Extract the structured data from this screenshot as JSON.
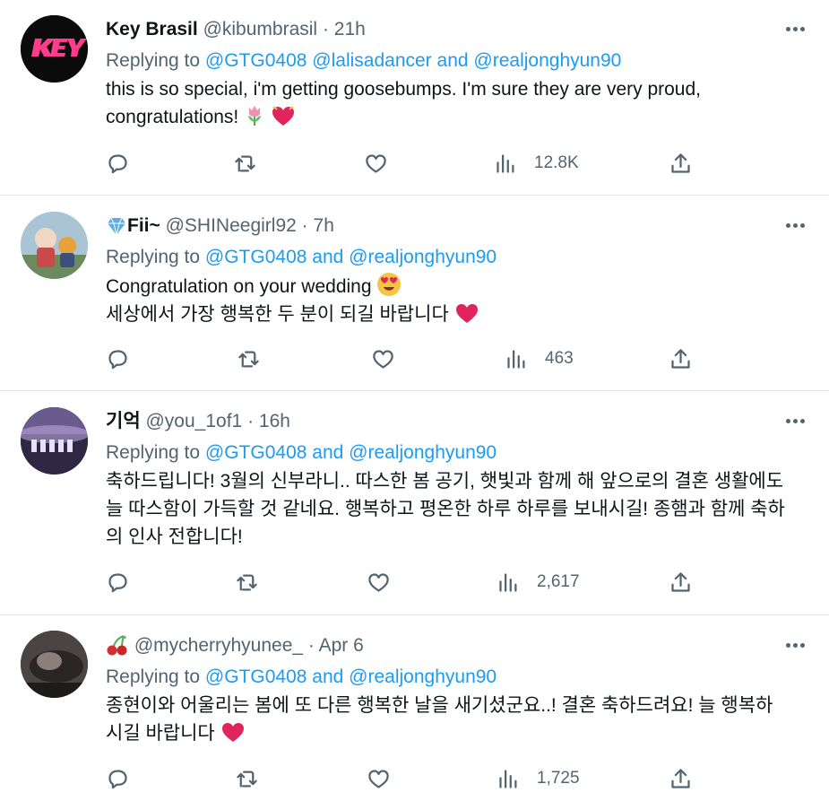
{
  "tweets": [
    {
      "display_name": "Key Brasil",
      "handle": "@kibumbrasil",
      "time": "21h",
      "replying_prefix": "Replying to ",
      "replying_1": "@GTG0408",
      "replying_2": "@lalisadancer",
      "replying_and": "and",
      "replying_3": "@realjonghyun90",
      "line1": "this is so special, i'm getting goosebumps. I'm sure they are very proud,",
      "line2": "congratulations!",
      "views": "12.8K"
    },
    {
      "display_name": "Fii~",
      "handle": "@SHINeegirl92",
      "time": "7h",
      "replying_prefix": "Replying to ",
      "replying_1": "@GTG0408",
      "replying_and": "and",
      "replying_2": "@realjonghyun90",
      "line1": "Congratulation on your wedding",
      "line2": "세상에서 가장 행복한 두 분이 되길 바랍니다",
      "views": "463"
    },
    {
      "display_name": "기억",
      "handle": "@you_1of1",
      "time": "16h",
      "replying_prefix": "Replying to ",
      "replying_1": "@GTG0408",
      "replying_and": "and",
      "replying_2": "@realjonghyun90",
      "line1": "축하드립니다! 3월의 신부라니.. 따스한 봄 공기, 햇빛과 함께 해 앞으로의 결혼 생활에도",
      "line2": "늘 따스함이 가득할 것 같네요. 행복하고 평온한 하루 하루를 보내시길! 종햄과 함께 축하",
      "line3": "의 인사 전합니다!",
      "views": "2,617"
    },
    {
      "display_name": "",
      "handle": "@mycherryhyunee_",
      "time": "Apr 6",
      "replying_prefix": "Replying to ",
      "replying_1": "@GTG0408",
      "replying_and": "and",
      "replying_2": "@realjonghyun90",
      "line1": "종현이와 어울리는 봄에 또 다른 행복한 날을 새기셨군요..! 결혼 축하드려요! 늘 행복하",
      "line2": "시길 바랍니다",
      "views": "1,725"
    }
  ],
  "separator": "·",
  "icons": [
    "reply-icon",
    "retweet-icon",
    "like-icon",
    "views-icon",
    "share-icon",
    "more-icon"
  ],
  "colors": {
    "link": "#1d9bf0",
    "muted": "#536471",
    "heart": "#e0245e"
  }
}
